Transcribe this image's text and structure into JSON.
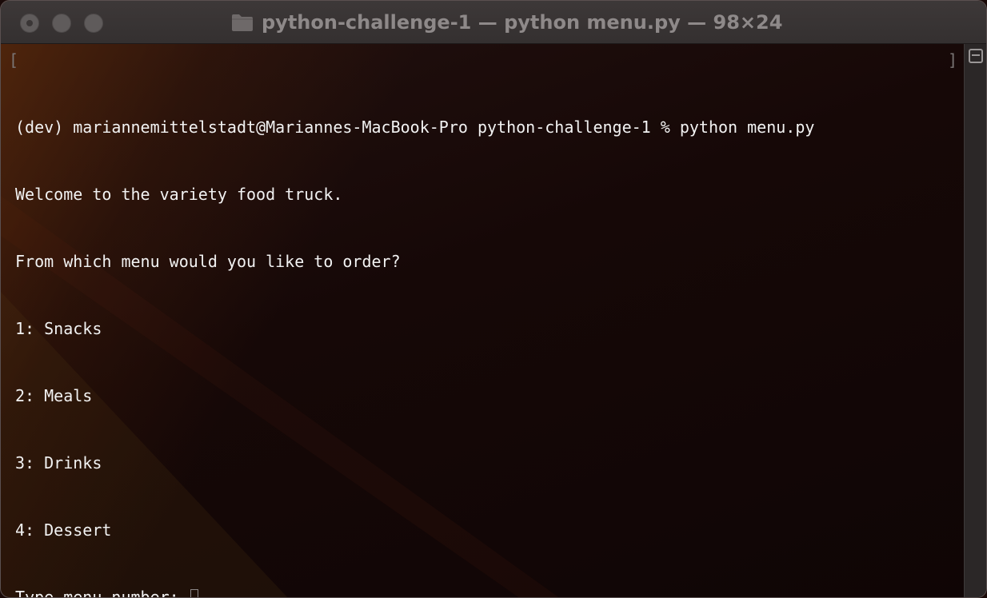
{
  "window": {
    "title": "python-challenge-1 — python menu.py — 98×24",
    "title_icon": "folder-icon"
  },
  "terminal": {
    "lines": [
      "(dev) mariannemittelstadt@Mariannes-MacBook-Pro python-challenge-1 % python menu.py",
      "Welcome to the variety food truck.",
      "From which menu would you like to order?",
      "1: Snacks",
      "2: Meals",
      "3: Drinks",
      "4: Dessert"
    ],
    "prompt": "Type menu number: ",
    "input_value": ""
  },
  "colors": {
    "text": "#f2f2f2",
    "titlebar": "#3a3535",
    "title_text": "#8e8989"
  }
}
